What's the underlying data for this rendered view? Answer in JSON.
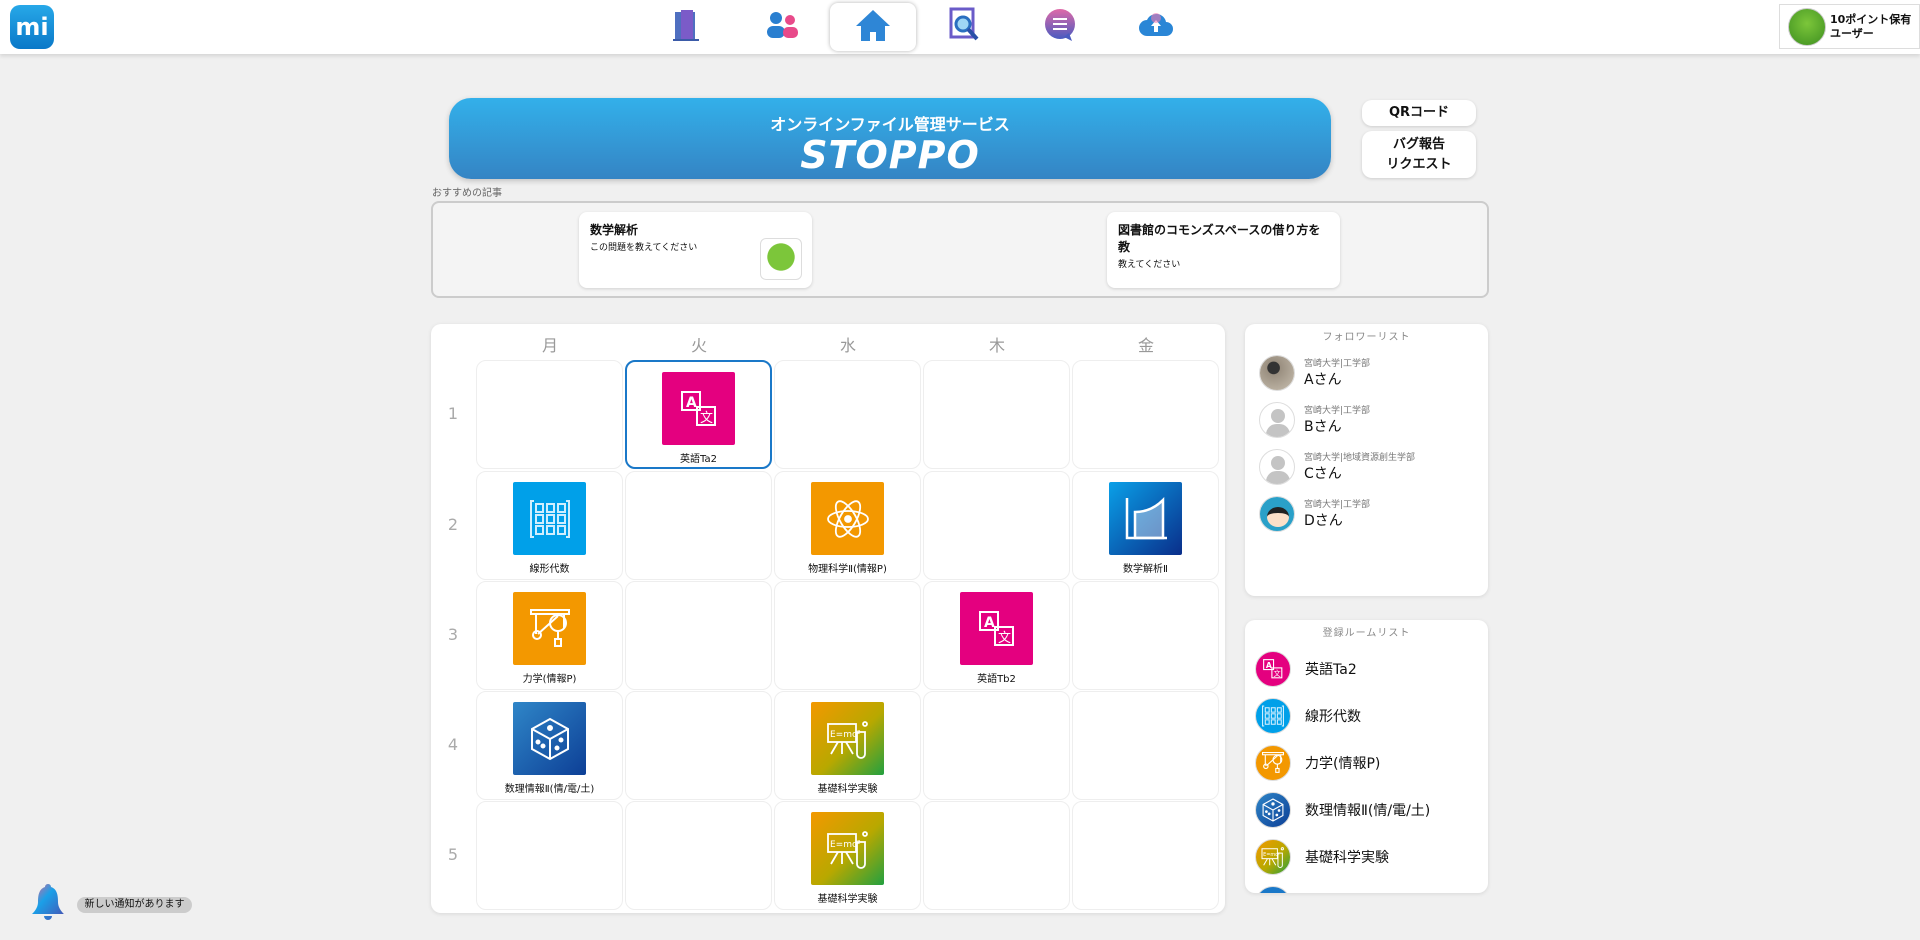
{
  "header": {
    "logo": "mi",
    "nav": [
      {
        "icon": "door-icon"
      },
      {
        "icon": "users-icon"
      },
      {
        "icon": "home-icon",
        "active": true
      },
      {
        "icon": "search-document-icon"
      },
      {
        "icon": "chat-icon"
      },
      {
        "icon": "cloud-upload-icon"
      }
    ],
    "user": {
      "points": "10ポイント保有",
      "name": "ユーザー"
    }
  },
  "banner": {
    "subtitle": "オンラインファイル管理サービス",
    "title": "STOPPO"
  },
  "side_buttons": {
    "qr": "QRコード",
    "bug_line1": "バグ報告",
    "bug_line2": "リクエスト"
  },
  "recommended": {
    "label": "おすすめの記事",
    "articles": [
      {
        "title": "数学解析",
        "body": "この問題を教えてください"
      },
      {
        "title": "図書館のコモンズスペースの借り方を教",
        "body": "教えてください"
      }
    ]
  },
  "timetable": {
    "days": [
      "月",
      "火",
      "水",
      "木",
      "金"
    ],
    "periods": [
      "1",
      "2",
      "3",
      "4",
      "5"
    ],
    "classes": [
      {
        "day": 1,
        "period": 0,
        "name": "英語Ta2",
        "icon": "translate",
        "color": "#e4007f",
        "selected": true
      },
      {
        "day": 0,
        "period": 1,
        "name": "線形代数",
        "icon": "matrix",
        "color": "#00a0e9"
      },
      {
        "day": 2,
        "period": 1,
        "name": "物理科学Ⅱ(情報P)",
        "icon": "atom",
        "color": "#f39800"
      },
      {
        "day": 4,
        "period": 1,
        "name": "数学解析Ⅱ",
        "icon": "integral",
        "color": "#0b5aa8"
      },
      {
        "day": 0,
        "period": 2,
        "name": "力学(情報P)",
        "icon": "pulley",
        "color": "#f39800"
      },
      {
        "day": 3,
        "period": 2,
        "name": "英語Tb2",
        "icon": "translate",
        "color": "#e4007f"
      },
      {
        "day": 0,
        "period": 3,
        "name": "数理情報Ⅱ(情/電/土)",
        "icon": "dice",
        "color": "#1c64b0"
      },
      {
        "day": 2,
        "period": 3,
        "name": "基礎科学実験",
        "icon": "experiment",
        "color": "#b8a800"
      },
      {
        "day": 2,
        "period": 4,
        "name": "基礎科学実験",
        "icon": "experiment",
        "color": "#b8a800"
      }
    ]
  },
  "followers": {
    "title": "フォロワーリスト",
    "items": [
      {
        "univ": "宮崎大学|工学部",
        "name": "Aさん",
        "avatar": "photo"
      },
      {
        "univ": "宮崎大学|工学部",
        "name": "Bさん",
        "avatar": "default"
      },
      {
        "univ": "宮崎大学|地域資源創生学部",
        "name": "Cさん",
        "avatar": "default"
      },
      {
        "univ": "宮崎大学|工学部",
        "name": "Dさん",
        "avatar": "character"
      }
    ]
  },
  "rooms": {
    "title": "登録ルームリスト",
    "items": [
      {
        "name": "英語Ta2",
        "color": "#e4007f"
      },
      {
        "name": "線形代数",
        "color": "#00a0e9"
      },
      {
        "name": "力学(情報P)",
        "color": "#f39800"
      },
      {
        "name": "数理情報Ⅱ(情/電/土)",
        "color": "#1c64b0"
      },
      {
        "name": "基礎科学実験",
        "color": "#b8a800"
      }
    ]
  },
  "notification": {
    "text": "新しい通知があります"
  }
}
